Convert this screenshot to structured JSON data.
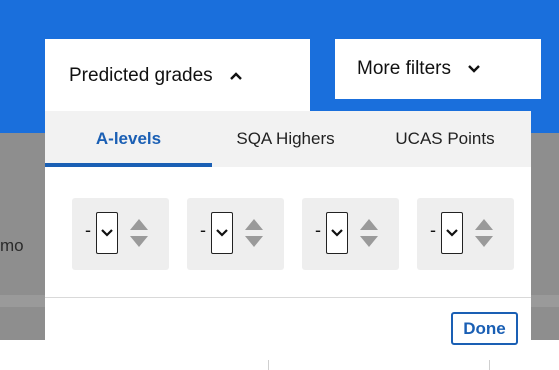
{
  "filters": {
    "predicted_label": "Predicted grades",
    "more_label": "More filters"
  },
  "background": {
    "fragment_text": "mo"
  },
  "tabs": [
    {
      "label": "A-levels",
      "selected": true
    },
    {
      "label": "SQA Highers",
      "selected": false
    },
    {
      "label": "UCAS Points",
      "selected": false
    }
  ],
  "grades": [
    {
      "value": "-"
    },
    {
      "value": "-"
    },
    {
      "value": "-"
    },
    {
      "value": "-"
    }
  ],
  "done_label": "Done",
  "colors": {
    "header_blue": "#1a6fdc",
    "accent_blue": "#1a5fb4",
    "overlay_gray": "#8e8e8e"
  }
}
